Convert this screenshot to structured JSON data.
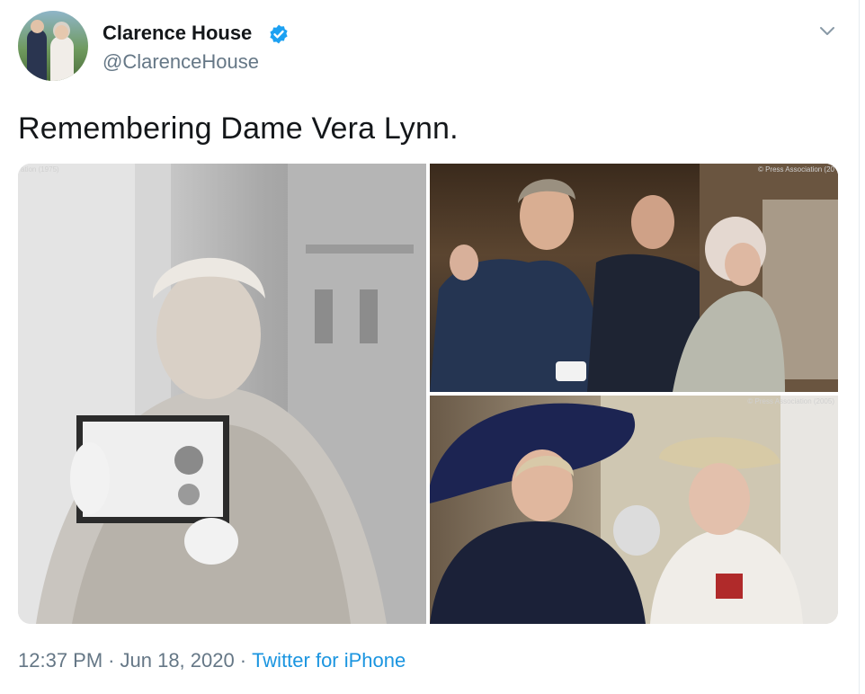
{
  "account": {
    "display_name": "Clarence House",
    "handle": "@ClarenceHouse",
    "verified": true,
    "avatar_icon": "avatar-photo"
  },
  "tweet": {
    "text": "Remembering Dame Vera Lynn.",
    "time": "12:37 PM",
    "separator": "·",
    "date": "Jun 18, 2020",
    "source": "Twitter for iPhone"
  },
  "media": {
    "photo1_credit": "ation (1975)",
    "photo2_credit": "© Press Association (20",
    "photo3_credit": "© Press Association (2005)"
  },
  "colors": {
    "text": "#14171a",
    "secondary": "#657786",
    "link": "#1b95e0",
    "verified": "#1da1f2"
  },
  "icons": {
    "verified": "verified-badge-icon",
    "menu": "chevron-down-icon"
  }
}
